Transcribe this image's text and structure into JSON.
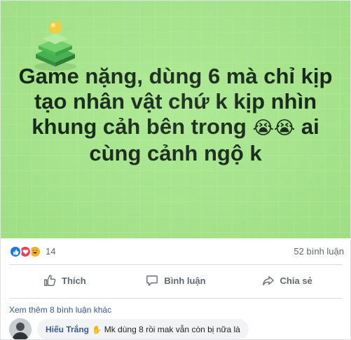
{
  "post": {
    "text_lines": [
      "Game nặng, dùng 6 mà chỉ kịp",
      "tạo nhân vật chứ k kịp nhìn",
      "khung cảh bên trong",
      "ai",
      "cùng cảnh ngộ k"
    ],
    "text_emoji": "😭😭",
    "background_color": "#a6e78a"
  },
  "reactions": {
    "count": "14",
    "comments_label": "52 bình luận",
    "icons": [
      "like-icon",
      "love-icon",
      "haha-icon"
    ]
  },
  "actions": {
    "like_label": "Thích",
    "comment_label": "Bình luận",
    "share_label": "Chia sẻ"
  },
  "comments": {
    "more_label": "Xem thêm 8 bình luận khác",
    "items": [
      {
        "author": "Hiếu Trắng",
        "hand": "✋",
        "text": "Mk dùng 8 rồi mak vẫn còn bị nữa là"
      }
    ]
  },
  "colors": {
    "link": "#385898",
    "like": "#1877f2",
    "love": "#f33e58",
    "haha": "#f7b125",
    "muted": "#606770"
  }
}
